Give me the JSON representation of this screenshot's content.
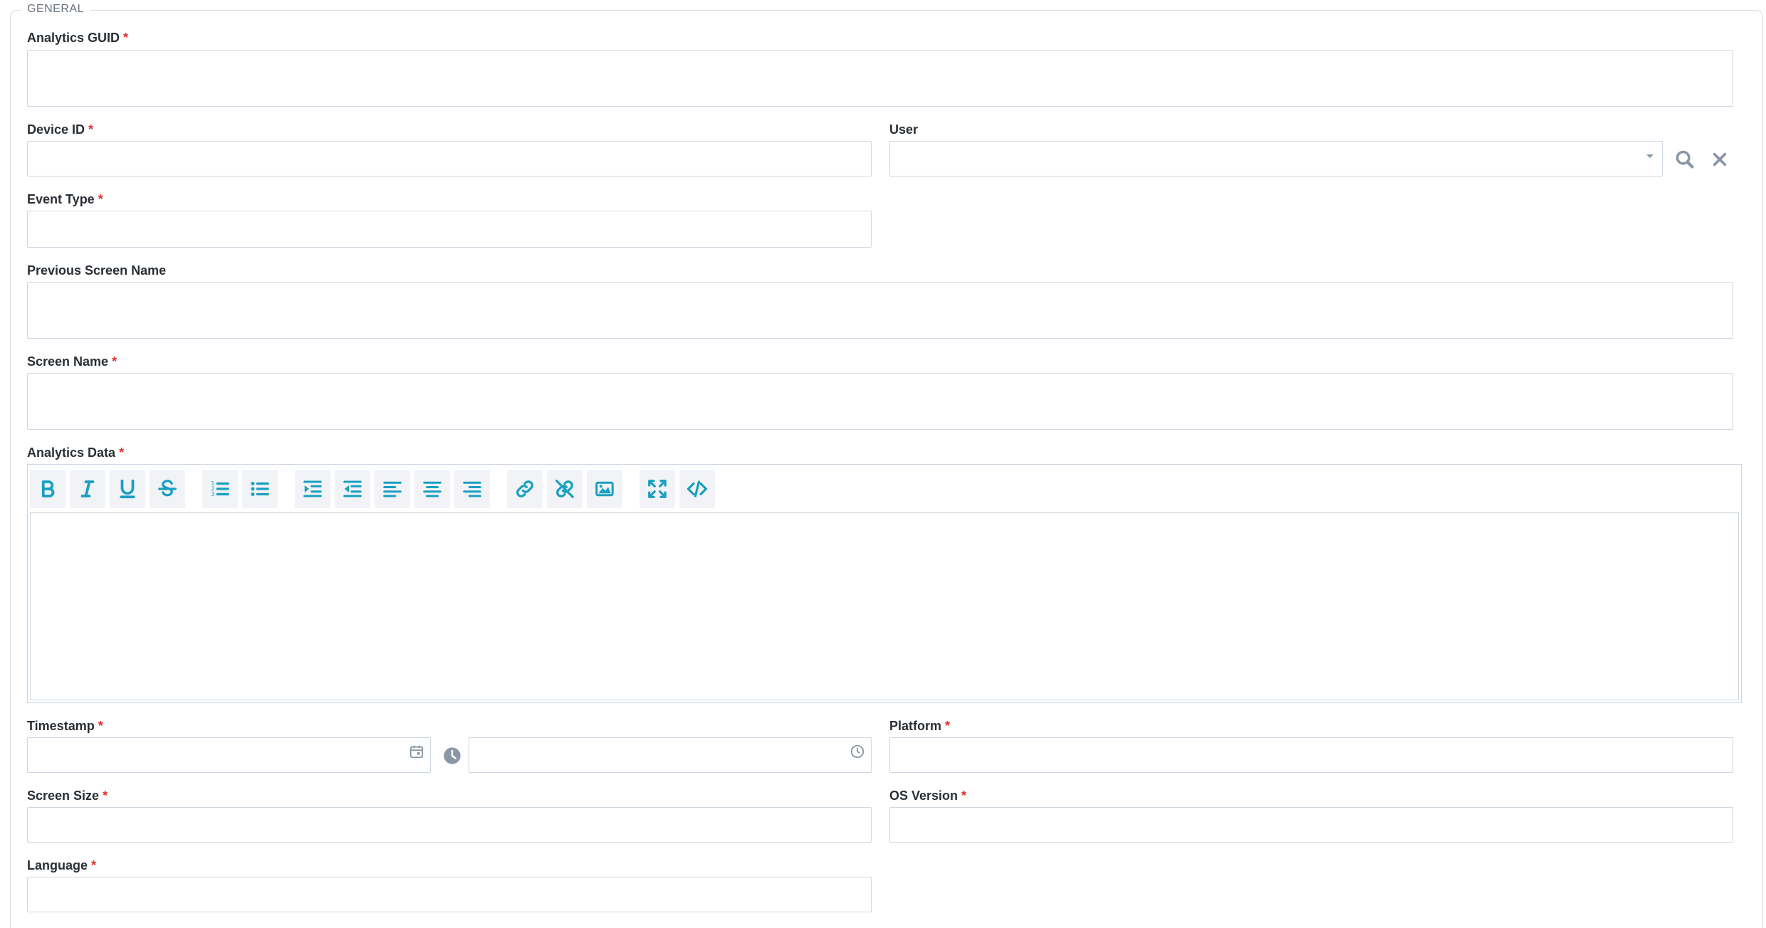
{
  "section": {
    "legend": "GENERAL"
  },
  "fields": {
    "analytics_guid": {
      "label": "Analytics GUID",
      "required": "*",
      "value": ""
    },
    "device_id": {
      "label": "Device ID",
      "required": "*",
      "value": ""
    },
    "user": {
      "label": "User",
      "value": ""
    },
    "event_type": {
      "label": "Event Type",
      "required": "*",
      "value": ""
    },
    "previous_screen_name": {
      "label": "Previous Screen Name",
      "value": ""
    },
    "screen_name": {
      "label": "Screen Name",
      "required": "*",
      "value": ""
    },
    "analytics_data": {
      "label": "Analytics Data",
      "required": "*",
      "value": ""
    },
    "timestamp": {
      "label": "Timestamp",
      "required": "*",
      "date_value": "",
      "time_value": ""
    },
    "platform": {
      "label": "Platform",
      "required": "*",
      "value": ""
    },
    "screen_size": {
      "label": "Screen Size",
      "required": "*",
      "value": ""
    },
    "os_version": {
      "label": "OS Version",
      "required": "*",
      "value": ""
    },
    "language": {
      "label": "Language",
      "required": "*",
      "value": ""
    }
  },
  "toolbar_icons": [
    "bold-icon",
    "italic-icon",
    "underline-icon",
    "strikethrough-icon",
    "ordered-list-icon",
    "unordered-list-icon",
    "indent-icon",
    "outdent-icon",
    "align-left-icon",
    "align-center-icon",
    "align-right-icon",
    "link-icon",
    "unlink-icon",
    "image-icon",
    "fullscreen-icon",
    "code-view-icon"
  ],
  "colors": {
    "accent": "#1a9fc0",
    "required": "#e0312f",
    "border": "#cdd7e1",
    "muted_icon": "#8a96a3"
  }
}
